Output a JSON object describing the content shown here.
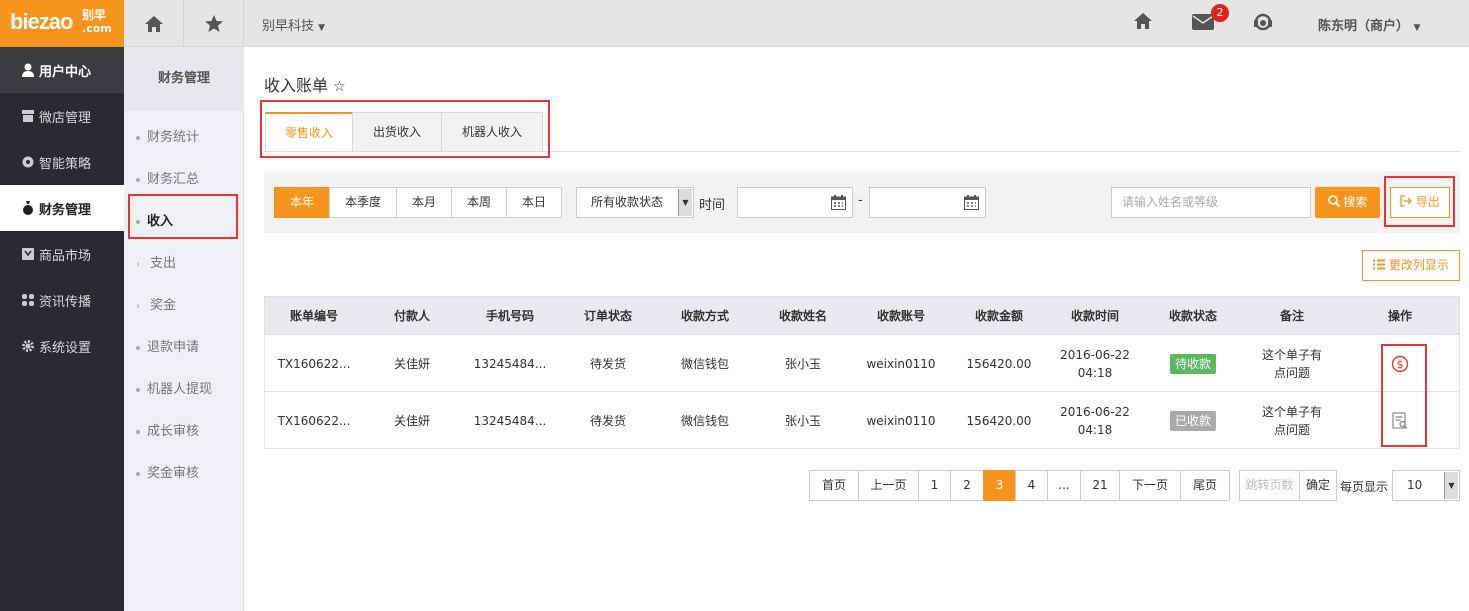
{
  "header": {
    "logo_text": "biezao",
    "logo_cn": "别早",
    "logo_com": ".com",
    "company": "别早科技",
    "mail_badge": "2",
    "user": "陈东明（商户）"
  },
  "nav": {
    "items": [
      {
        "label": "用户中心",
        "icon": "user-icon"
      },
      {
        "label": "微店管理",
        "icon": "shop-icon"
      },
      {
        "label": "智能策略",
        "icon": "strategy-icon"
      },
      {
        "label": "财务管理",
        "icon": "money-bag-icon"
      },
      {
        "label": "商品市场",
        "icon": "market-icon"
      },
      {
        "label": "资讯传播",
        "icon": "grid-icon"
      },
      {
        "label": "系统设置",
        "icon": "gear-icon"
      }
    ]
  },
  "subnav": {
    "title": "财务管理",
    "items": [
      {
        "label": "财务统计"
      },
      {
        "label": "财务汇总"
      },
      {
        "label": "收入"
      },
      {
        "label": "支出"
      },
      {
        "label": "奖金"
      },
      {
        "label": "退款申请"
      },
      {
        "label": "机器人提现"
      },
      {
        "label": "成长审核"
      },
      {
        "label": "奖金审核"
      }
    ]
  },
  "page": {
    "title": "收入账单",
    "tabs": [
      "零售收入",
      "出货收入",
      "机器人收入"
    ]
  },
  "filter": {
    "periods": [
      "本年",
      "本季度",
      "本月",
      "本周",
      "本日"
    ],
    "status_select": "所有收款状态",
    "time_label": "时间",
    "date_separator": "-",
    "search_placeholder": "请输入姓名或等级",
    "search_label": "搜索",
    "export_label": "导出",
    "columns_label": "更改列显示"
  },
  "table": {
    "headers": [
      "账单编号",
      "付款人",
      "手机号码",
      "订单状态",
      "收款方式",
      "收款姓名",
      "收款账号",
      "收款金额",
      "收款时间",
      "收款状态",
      "备注",
      "操作"
    ],
    "rows": [
      {
        "bill_no": "TX160622...",
        "payer": "关佳妍",
        "phone": "13245484...",
        "order_status": "待发货",
        "method": "微信钱包",
        "name": "张小玉",
        "account": "weixin0110",
        "amount": "156420.00",
        "date": "2016-06-22",
        "time": "04:18",
        "status": "待收款",
        "status_color": "#5cb85c",
        "note1": "这个单子有",
        "note2": "点问题",
        "action_icon": "dollar-circle-icon"
      },
      {
        "bill_no": "TX160622...",
        "payer": "关佳妍",
        "phone": "13245484...",
        "order_status": "待发货",
        "method": "微信钱包",
        "name": "张小玉",
        "account": "weixin0110",
        "amount": "156420.00",
        "date": "2016-06-22",
        "time": "04:18",
        "status": "已收款",
        "status_color": "#aaaaaa",
        "note1": "这个单子有",
        "note2": "点问题",
        "action_icon": "document-search-icon"
      }
    ]
  },
  "pagination": {
    "first": "首页",
    "prev": "上一页",
    "pages": [
      "1",
      "2",
      "3",
      "4",
      "...",
      "21"
    ],
    "current": "3",
    "next": "下一页",
    "last": "尾页",
    "jump_placeholder": "跳转页数",
    "confirm": "确定",
    "per_page_label": "每页显示",
    "per_page": "10"
  },
  "colors": {
    "accent": "#f7941d",
    "highlight_box": "#ee3333",
    "nav_bg": "#2b2b2f"
  }
}
